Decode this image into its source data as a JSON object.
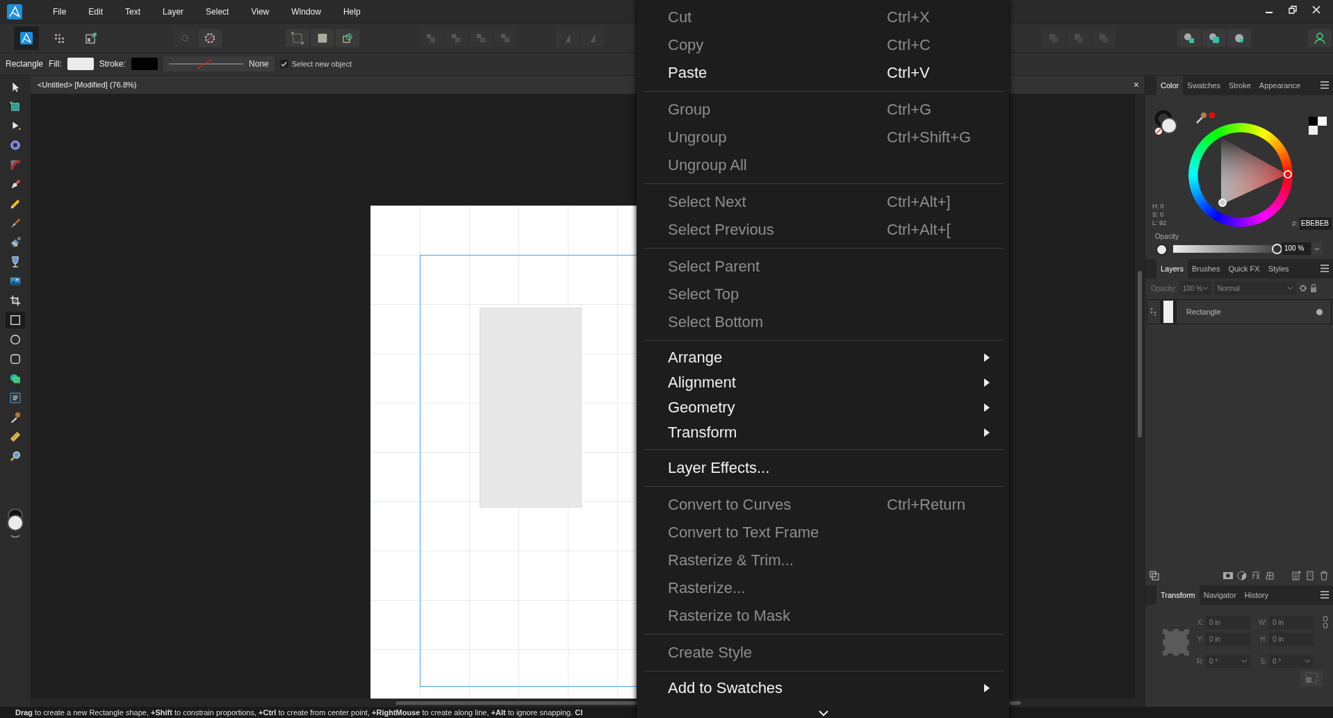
{
  "menubar": {
    "items": [
      "File",
      "Edit",
      "Text",
      "Layer",
      "Select",
      "View",
      "Window",
      "Help"
    ]
  },
  "context_toolbar": {
    "tool_name": "Rectangle",
    "fill_label": "Fill:",
    "stroke_label": "Stroke:",
    "stroke_style": "None",
    "select_new_object": {
      "label": "Select new object",
      "checked": true
    }
  },
  "tools": [
    {
      "kind": "move",
      "selected": false
    },
    {
      "kind": "artboard",
      "selected": false
    },
    {
      "kind": "node",
      "selected": false
    },
    {
      "kind": "contour",
      "selected": false
    },
    {
      "kind": "corner",
      "selected": false
    },
    {
      "kind": "pen",
      "selected": false
    },
    {
      "kind": "pencil",
      "selected": false
    },
    {
      "kind": "brush",
      "selected": false
    },
    {
      "kind": "fill",
      "selected": false
    },
    {
      "kind": "transparency",
      "selected": false
    },
    {
      "kind": "image",
      "selected": false
    },
    {
      "kind": "crop",
      "selected": false
    },
    {
      "kind": "rectangle",
      "selected": true
    },
    {
      "kind": "ellipse",
      "selected": false
    },
    {
      "kind": "rounded",
      "selected": false
    },
    {
      "kind": "builder",
      "selected": false
    },
    {
      "kind": "text",
      "selected": false
    },
    {
      "kind": "picker",
      "selected": false
    },
    {
      "kind": "ruler",
      "selected": false
    },
    {
      "kind": "zoom",
      "selected": false
    }
  ],
  "document": {
    "title": "<Untitled> [Modified] (76.8%)",
    "close": "×"
  },
  "color_panel": {
    "tabs": [
      {
        "label": "Color",
        "selected": true
      },
      {
        "label": "Swatches",
        "selected": false
      },
      {
        "label": "Stroke",
        "selected": false
      },
      {
        "label": "Appearance",
        "selected": false
      }
    ],
    "hsl": [
      "H: 0",
      "S: 0",
      "L: 92"
    ],
    "hex_label": "#:",
    "hex": "EBEBEB",
    "opacity_label": "Opacity",
    "opacity": "100 %",
    "level": 1
  },
  "layers_panel": {
    "tabs": [
      {
        "label": "Layers",
        "selected": true
      },
      {
        "label": "Brushes",
        "selected": false
      },
      {
        "label": "Quick FX",
        "selected": false
      },
      {
        "label": "Styles",
        "selected": false
      }
    ],
    "opacity_label": "Opacity:",
    "opacity": "100 %",
    "blend_mode": "Normal",
    "layers": [
      {
        "name": "Rectangle",
        "visible": true
      }
    ]
  },
  "transform_panel": {
    "tabs": [
      {
        "label": "Transform",
        "selected": true
      },
      {
        "label": "Navigator",
        "selected": false
      },
      {
        "label": "History",
        "selected": false
      }
    ],
    "fields": [
      {
        "label": "X:",
        "value": "0 in",
        "kind": "text"
      },
      {
        "label": "W:",
        "value": "0 in",
        "kind": "text"
      },
      {
        "label": "Y:",
        "value": "0 in",
        "kind": "text"
      },
      {
        "label": "H:",
        "value": "0 in",
        "kind": "text"
      },
      {
        "label": "R:",
        "value": "0 °",
        "kind": "dropdown"
      },
      {
        "label": "S:",
        "value": "0 °",
        "kind": "dropdown"
      }
    ]
  },
  "status_bar": {
    "text": "**Drag** to create a new Rectangle shape, **+Shift** to constrain proportions, **+Ctrl** to create from center point, **+RightMouse** to create along line, **+Alt** to ignore snapping. **Cl**"
  },
  "context_menu": {
    "items": [
      {
        "kind": "item",
        "label": "Cut",
        "shortcut": "Ctrl+X",
        "disabled": true
      },
      {
        "kind": "item",
        "label": "Copy",
        "shortcut": "Ctrl+C",
        "disabled": true
      },
      {
        "kind": "item",
        "label": "Paste",
        "shortcut": "Ctrl+V",
        "disabled": false
      },
      {
        "kind": "separator"
      },
      {
        "kind": "item",
        "label": "Group",
        "shortcut": "Ctrl+G",
        "disabled": true
      },
      {
        "kind": "item",
        "label": "Ungroup",
        "shortcut": "Ctrl+Shift+G",
        "disabled": true
      },
      {
        "kind": "item",
        "label": "Ungroup All",
        "disabled": true
      },
      {
        "kind": "separator"
      },
      {
        "kind": "item",
        "label": "Select Next",
        "shortcut": "Ctrl+Alt+]",
        "disabled": true
      },
      {
        "kind": "item",
        "label": "Select Previous",
        "shortcut": "Ctrl+Alt+[",
        "disabled": true
      },
      {
        "kind": "separator"
      },
      {
        "kind": "item",
        "label": "Select Parent",
        "disabled": true
      },
      {
        "kind": "item",
        "label": "Select Top",
        "disabled": true
      },
      {
        "kind": "item",
        "label": "Select Bottom",
        "disabled": true
      },
      {
        "kind": "separator"
      },
      {
        "kind": "submenu",
        "label": "Arrange",
        "disabled": false
      },
      {
        "kind": "submenu",
        "label": "Alignment",
        "disabled": false
      },
      {
        "kind": "submenu",
        "label": "Geometry",
        "disabled": false
      },
      {
        "kind": "submenu",
        "label": "Transform",
        "disabled": false
      },
      {
        "kind": "separator"
      },
      {
        "kind": "item",
        "label": "Layer Effects...",
        "disabled": false
      },
      {
        "kind": "separator"
      },
      {
        "kind": "item",
        "label": "Convert to Curves",
        "shortcut": "Ctrl+Return",
        "disabled": true
      },
      {
        "kind": "item",
        "label": "Convert to Text Frame",
        "disabled": true
      },
      {
        "kind": "item",
        "label": "Rasterize & Trim...",
        "disabled": true
      },
      {
        "kind": "item",
        "label": "Rasterize...",
        "disabled": true
      },
      {
        "kind": "item",
        "label": "Rasterize to Mask",
        "disabled": true
      },
      {
        "kind": "separator"
      },
      {
        "kind": "item",
        "label": "Create Style",
        "disabled": true
      },
      {
        "kind": "separator"
      },
      {
        "kind": "submenu",
        "label": "Add to Swatches",
        "disabled": false
      }
    ]
  }
}
